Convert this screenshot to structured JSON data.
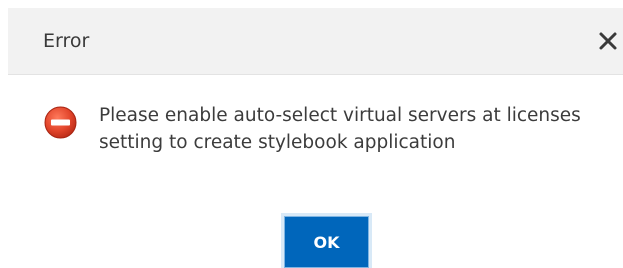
{
  "dialog": {
    "title": "Error",
    "message": "Please enable auto-select virtual servers at licenses setting to create stylebook application",
    "ok_label": "OK",
    "close_icon": "close-icon",
    "status_icon": "error-icon",
    "colors": {
      "header_bg": "#f2f2f2",
      "ok_bg": "#0066bb",
      "error_red": "#e2452b"
    }
  }
}
